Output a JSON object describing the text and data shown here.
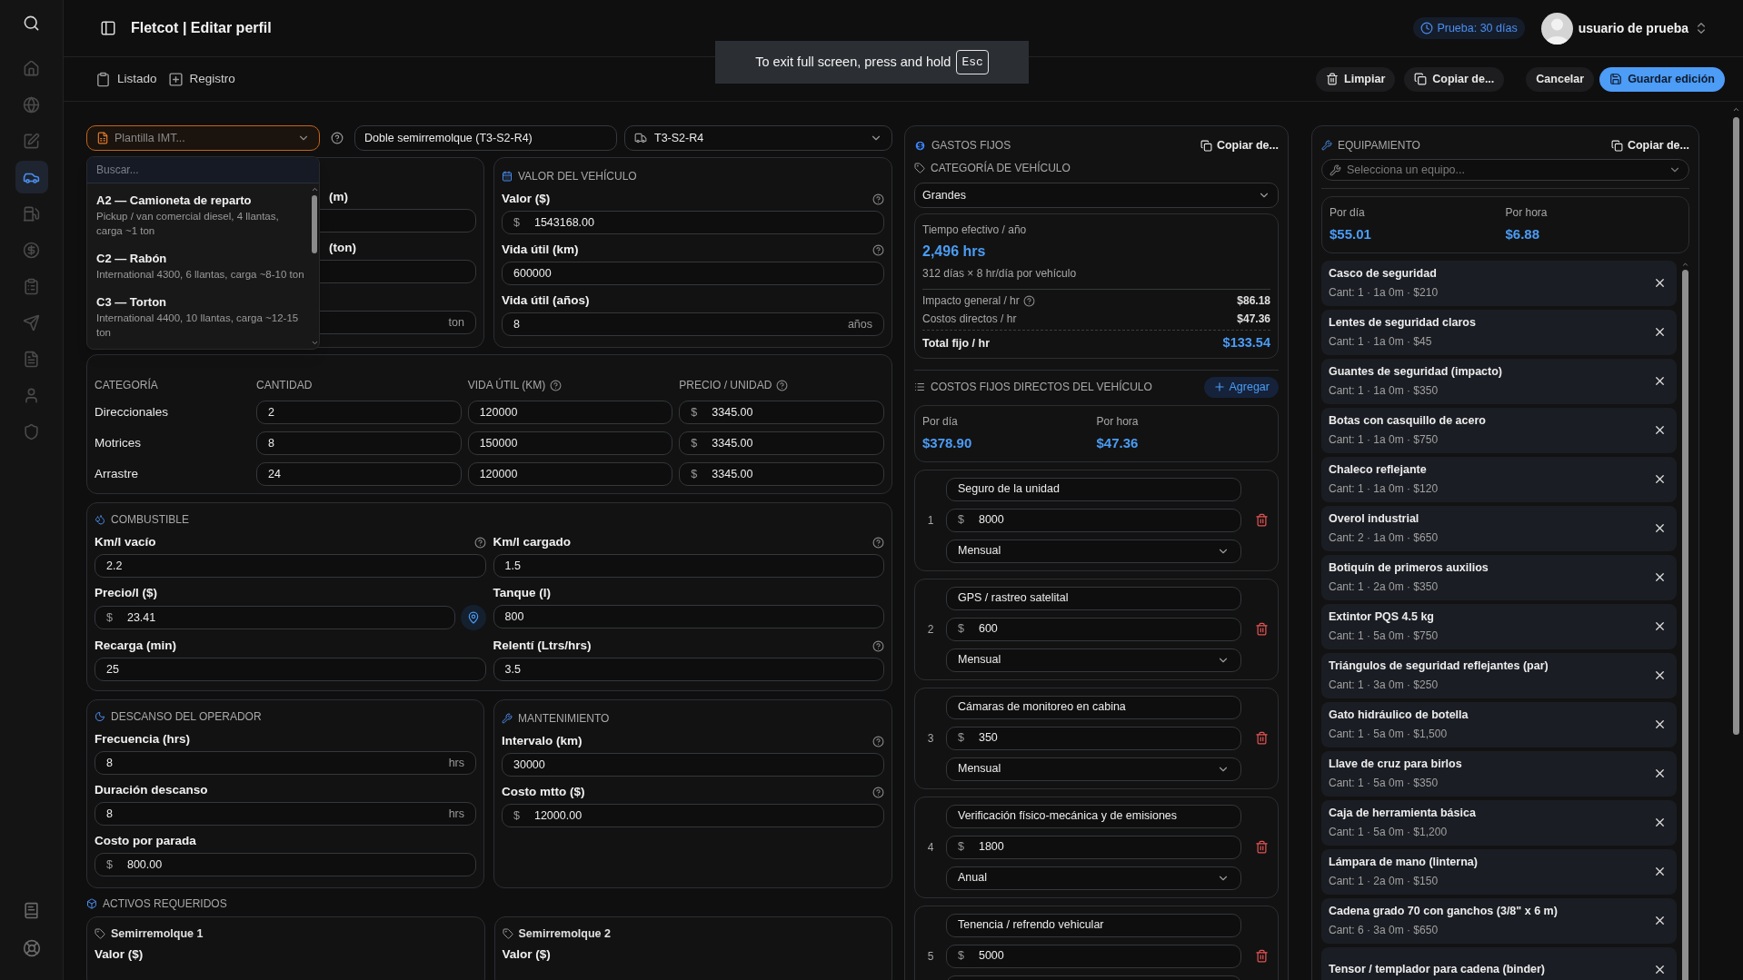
{
  "header": {
    "title": "Fletcot | Editar perfil",
    "trial": "Prueba: 30 días",
    "user": "usuario de prueba"
  },
  "fullscreen_notice": {
    "text": "To exit full screen, press and hold",
    "key": "Esc"
  },
  "sidebar": {
    "items": [
      {
        "selected": false
      },
      {
        "selected": false
      },
      {
        "selected": false
      },
      {
        "selected": true
      },
      {
        "selected": false
      },
      {
        "selected": false
      },
      {
        "selected": false
      },
      {
        "selected": false
      },
      {
        "selected": false
      },
      {
        "selected": false
      },
      {
        "selected": false
      }
    ]
  },
  "tabs": [
    {
      "label": "Listado",
      "selected": false
    },
    {
      "label": "Registro",
      "selected": false
    }
  ],
  "actions": [
    {
      "label": "Limpiar",
      "kind": "ghost"
    },
    {
      "label": "Copiar de...",
      "kind": "ghost"
    },
    {
      "label": "Cancelar",
      "kind": "plain"
    },
    {
      "label": "Guardar edición",
      "kind": "primary"
    }
  ],
  "toolbar": {
    "template": {
      "placeholder": "Plantilla IMT...",
      "open": true
    },
    "vehicle_name": "Doble semirremolque (T3-S2-R4)",
    "config": "T3-S2-R4"
  },
  "template_dropdown": {
    "search_placeholder": "Buscar...",
    "options": [
      {
        "title": "A2 — Camioneta de reparto",
        "description": "Pickup / van comercial diesel, 4 llantas, carga ~1 ton"
      },
      {
        "title": "C2 — Rabón",
        "description": "International 4300, 6 llantas, carga ~8-10 ton"
      },
      {
        "title": "C3 — Torton",
        "description": "International 4400, 10 llantas, carga ~12-15 ton"
      }
    ]
  },
  "dimensions": {
    "fields": [
      {
        "label": "(m)"
      },
      {
        "label": "(ton)"
      },
      {
        "suffix": "ton"
      }
    ]
  },
  "vehicle_value": {
    "title": "VALOR DEL VEHÍCULO",
    "fields": [
      {
        "label": "Valor ($)",
        "prefix": "$",
        "value": "1543168.00",
        "help": true
      },
      {
        "label": "Vida útil (km)",
        "value": "600000",
        "help": true
      },
      {
        "label": "Vida útil (años)",
        "value": "8",
        "suffix": "años",
        "help": false
      }
    ]
  },
  "tires": {
    "columns": [
      {
        "label": "CATEGORÍA",
        "help": false
      },
      {
        "label": "CANTIDAD",
        "help": false
      },
      {
        "label": "VIDA ÚTIL (KM)",
        "help": true
      },
      {
        "label": "PRECIO / UNIDAD",
        "help": true
      }
    ],
    "rows": [
      {
        "category": "Direccionales",
        "quantity": "2",
        "life_km": "120000",
        "price_prefix": "$",
        "price": "3345.00"
      },
      {
        "category": "Motrices",
        "quantity": "8",
        "life_km": "150000",
        "price_prefix": "$",
        "price": "3345.00"
      },
      {
        "category": "Arrastre",
        "quantity": "24",
        "life_km": "120000",
        "price_prefix": "$",
        "price": "3345.00"
      }
    ]
  },
  "fuel": {
    "title": "COMBUSTIBLE",
    "fields": [
      {
        "label": "Km/l vacío",
        "value": "2.2",
        "help": true
      },
      {
        "label": "Km/l cargado",
        "value": "1.5",
        "help": true
      },
      {
        "label": "Precio/l ($)",
        "prefix": "$",
        "value": "23.41",
        "help": false,
        "locate": true
      },
      {
        "label": "Tanque (l)",
        "value": "800",
        "help": false
      },
      {
        "label": "Recarga (min)",
        "value": "25",
        "help": false
      },
      {
        "label": "Relentí (Ltrs/hrs)",
        "value": "3.5",
        "help": true
      }
    ]
  },
  "rest": {
    "title": "DESCANSO DEL OPERADOR",
    "fields": [
      {
        "label": "Frecuencia (hrs)",
        "value": "8",
        "suffix": "hrs",
        "help": false
      },
      {
        "label": "Duración descanso",
        "value": "8",
        "suffix": "hrs",
        "help": false
      },
      {
        "label": "Costo por parada",
        "prefix": "$",
        "value": "800.00",
        "help": false
      }
    ]
  },
  "maintenance": {
    "title": "MANTENIMIENTO",
    "fields": [
      {
        "label": "Intervalo (km)",
        "value": "30000",
        "help": true
      },
      {
        "label": "Costo mtto ($)",
        "prefix": "$",
        "value": "12000.00",
        "help": true
      }
    ]
  },
  "assets": {
    "title": "ACTIVOS REQUERIDOS",
    "items": [
      {
        "name": "Semirremolque 1",
        "label": "Valor ($)"
      },
      {
        "name": "Semirremolque 2",
        "label": "Valor ($)"
      }
    ]
  },
  "fixed_costs": {
    "title": "GASTOS FIJOS",
    "copy": "Copiar de...",
    "category_label": "CATEGORÍA DE VEHÍCULO",
    "category": "Grandes",
    "summary": {
      "label": "Tiempo efectivo / año",
      "hours": "2,496 hrs",
      "detail": "312 días × 8 hr/día por vehículo",
      "lines": [
        {
          "label": "Impacto general / hr",
          "value": "$86.18",
          "help": true
        },
        {
          "label": "Costos directos / hr",
          "value": "$47.36",
          "help": false
        }
      ],
      "total_label": "Total fijo / hr",
      "total": "$133.54"
    },
    "direct_title": "COSTOS FIJOS DIRECTOS DEL VEHÍCULO",
    "add": "Agregar",
    "per_day_label": "Por día",
    "per_day": "$378.90",
    "per_hour_label": "Por hora",
    "per_hour": "$47.36",
    "items": [
      {
        "number": "1",
        "name": "Seguro de la unidad",
        "prefix": "$",
        "amount": "8000",
        "frequency": "Mensual"
      },
      {
        "number": "2",
        "name": "GPS / rastreo satelital",
        "prefix": "$",
        "amount": "600",
        "frequency": "Mensual"
      },
      {
        "number": "3",
        "name": "Cámaras de monitoreo en cabina",
        "prefix": "$",
        "amount": "350",
        "frequency": "Mensual"
      },
      {
        "number": "4",
        "name": "Verificación físico-mecánica y de emisiones",
        "prefix": "$",
        "amount": "1800",
        "frequency": "Anual"
      },
      {
        "number": "5",
        "name": "Tenencia / refrendo vehicular",
        "prefix": "$",
        "amount": "5000"
      }
    ]
  },
  "equipment": {
    "title": "EQUIPAMIENTO",
    "copy": "Copiar de...",
    "select_placeholder": "Selecciona un equipo...",
    "per_day_label": "Por día",
    "per_day": "$55.01",
    "per_hour_label": "Por hora",
    "per_hour": "$6.88",
    "items": [
      {
        "name": "Casco de seguridad",
        "detail": "Cant: 1 · 1a 0m · $210"
      },
      {
        "name": "Lentes de seguridad claros",
        "detail": "Cant: 1 · 1a 0m · $45"
      },
      {
        "name": "Guantes de seguridad (impacto)",
        "detail": "Cant: 1 · 1a 0m · $350"
      },
      {
        "name": "Botas con casquillo de acero",
        "detail": "Cant: 1 · 1a 0m · $750"
      },
      {
        "name": "Chaleco reflejante",
        "detail": "Cant: 1 · 1a 0m · $120"
      },
      {
        "name": "Overol industrial",
        "detail": "Cant: 2 · 1a 0m · $650"
      },
      {
        "name": "Botiquín de primeros auxilios",
        "detail": "Cant: 1 · 2a 0m · $350"
      },
      {
        "name": "Extintor PQS 4.5 kg",
        "detail": "Cant: 1 · 5a 0m · $750"
      },
      {
        "name": "Triángulos de seguridad reflejantes (par)",
        "detail": "Cant: 1 · 3a 0m · $250"
      },
      {
        "name": "Gato hidráulico de botella",
        "detail": "Cant: 1 · 5a 0m · $1,500"
      },
      {
        "name": "Llave de cruz para birlos",
        "detail": "Cant: 1 · 5a 0m · $350"
      },
      {
        "name": "Caja de herramienta básica",
        "detail": "Cant: 1 · 5a 0m · $1,200"
      },
      {
        "name": "Lámpara de mano (linterna)",
        "detail": "Cant: 1 · 2a 0m · $150"
      },
      {
        "name": "Cadena grado 70 con ganchos (3/8\" x 6 m)",
        "detail": "Cant: 6 · 3a 0m · $650"
      },
      {
        "name": "Tensor / templador para cadena (binder)"
      }
    ]
  }
}
